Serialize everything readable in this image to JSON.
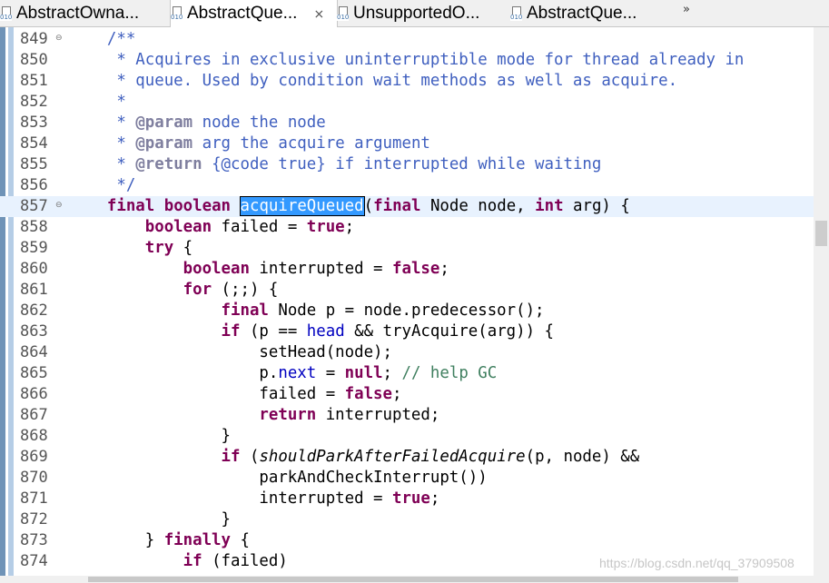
{
  "tabs": [
    {
      "label": "AbstractOwna...",
      "active": false
    },
    {
      "label": "AbstractQue...",
      "active": true
    },
    {
      "label": "UnsupportedO...",
      "active": false
    },
    {
      "label": "AbstractQue...",
      "active": false
    }
  ],
  "tab_close": "⨯",
  "overflow": "»",
  "lines": [
    {
      "num": "849",
      "fold": "⊖",
      "seg": [
        {
          "t": "    "
        },
        {
          "c": "jd",
          "t": "/**"
        }
      ]
    },
    {
      "num": "850",
      "seg": [
        {
          "t": "     "
        },
        {
          "c": "jd",
          "t": "* Acquires in exclusive uninterruptible mode for thread already in"
        }
      ]
    },
    {
      "num": "851",
      "seg": [
        {
          "t": "     "
        },
        {
          "c": "jd",
          "t": "* queue. Used by condition wait methods as well as acquire."
        }
      ]
    },
    {
      "num": "852",
      "seg": [
        {
          "t": "     "
        },
        {
          "c": "jd",
          "t": "*"
        }
      ]
    },
    {
      "num": "853",
      "seg": [
        {
          "t": "     "
        },
        {
          "c": "jd",
          "t": "* "
        },
        {
          "c": "jt",
          "t": "@param"
        },
        {
          "c": "jd",
          "t": " node the node"
        }
      ]
    },
    {
      "num": "854",
      "seg": [
        {
          "t": "     "
        },
        {
          "c": "jd",
          "t": "* "
        },
        {
          "c": "jt",
          "t": "@param"
        },
        {
          "c": "jd",
          "t": " arg the acquire argument"
        }
      ]
    },
    {
      "num": "855",
      "seg": [
        {
          "t": "     "
        },
        {
          "c": "jd",
          "t": "* "
        },
        {
          "c": "jt",
          "t": "@return"
        },
        {
          "c": "jd",
          "t": " {@code true} if interrupted while waiting"
        }
      ]
    },
    {
      "num": "856",
      "seg": [
        {
          "t": "     "
        },
        {
          "c": "jd",
          "t": "*/"
        }
      ]
    },
    {
      "num": "857",
      "fold": "⊖",
      "current": true,
      "seg": [
        {
          "t": "    "
        },
        {
          "c": "kw",
          "t": "final"
        },
        {
          "t": " "
        },
        {
          "c": "kw",
          "t": "boolean"
        },
        {
          "t": " "
        },
        {
          "c": "sel",
          "t": "acquireQueued"
        },
        {
          "t": "("
        },
        {
          "c": "kw",
          "t": "final"
        },
        {
          "t": " Node node, "
        },
        {
          "c": "kw",
          "t": "int"
        },
        {
          "t": " arg) {"
        }
      ]
    },
    {
      "num": "858",
      "seg": [
        {
          "t": "        "
        },
        {
          "c": "kw",
          "t": "boolean"
        },
        {
          "t": " failed = "
        },
        {
          "c": "kw",
          "t": "true"
        },
        {
          "t": ";"
        }
      ]
    },
    {
      "num": "859",
      "seg": [
        {
          "t": "        "
        },
        {
          "c": "kw",
          "t": "try"
        },
        {
          "t": " {"
        }
      ]
    },
    {
      "num": "860",
      "seg": [
        {
          "t": "            "
        },
        {
          "c": "kw",
          "t": "boolean"
        },
        {
          "t": " interrupted = "
        },
        {
          "c": "kw",
          "t": "false"
        },
        {
          "t": ";"
        }
      ]
    },
    {
      "num": "861",
      "seg": [
        {
          "t": "            "
        },
        {
          "c": "kw",
          "t": "for"
        },
        {
          "t": " (;;) {"
        }
      ]
    },
    {
      "num": "862",
      "seg": [
        {
          "t": "                "
        },
        {
          "c": "kw",
          "t": "final"
        },
        {
          "t": " Node p = node.predecessor();"
        }
      ]
    },
    {
      "num": "863",
      "seg": [
        {
          "t": "                "
        },
        {
          "c": "kw",
          "t": "if"
        },
        {
          "t": " (p == "
        },
        {
          "c": "fld",
          "t": "head"
        },
        {
          "t": " && tryAcquire(arg)) {"
        }
      ]
    },
    {
      "num": "864",
      "seg": [
        {
          "t": "                    setHead(node);"
        }
      ]
    },
    {
      "num": "865",
      "seg": [
        {
          "t": "                    p."
        },
        {
          "c": "fld",
          "t": "next"
        },
        {
          "t": " = "
        },
        {
          "c": "kw",
          "t": "null"
        },
        {
          "t": "; "
        },
        {
          "c": "cm",
          "t": "// help GC"
        }
      ]
    },
    {
      "num": "866",
      "seg": [
        {
          "t": "                    failed = "
        },
        {
          "c": "kw",
          "t": "false"
        },
        {
          "t": ";"
        }
      ]
    },
    {
      "num": "867",
      "seg": [
        {
          "t": "                    "
        },
        {
          "c": "kw",
          "t": "return"
        },
        {
          "t": " interrupted;"
        }
      ]
    },
    {
      "num": "868",
      "seg": [
        {
          "t": "                }"
        }
      ]
    },
    {
      "num": "869",
      "seg": [
        {
          "t": "                "
        },
        {
          "c": "kw",
          "t": "if"
        },
        {
          "t": " ("
        },
        {
          "c": "it",
          "t": "shouldParkAfterFailedAcquire"
        },
        {
          "t": "(p, node) &&"
        }
      ]
    },
    {
      "num": "870",
      "seg": [
        {
          "t": "                    parkAndCheckInterrupt())"
        }
      ]
    },
    {
      "num": "871",
      "seg": [
        {
          "t": "                    interrupted = "
        },
        {
          "c": "kw",
          "t": "true"
        },
        {
          "t": ";"
        }
      ]
    },
    {
      "num": "872",
      "seg": [
        {
          "t": "                }"
        }
      ]
    },
    {
      "num": "873",
      "seg": [
        {
          "t": "        } "
        },
        {
          "c": "kw",
          "t": "finally"
        },
        {
          "t": " {"
        }
      ]
    },
    {
      "num": "874",
      "seg": [
        {
          "t": "            "
        },
        {
          "c": "kw",
          "t": "if"
        },
        {
          "t": " (failed)"
        }
      ]
    }
  ],
  "watermark": "https://blog.csdn.net/qq_37909508"
}
